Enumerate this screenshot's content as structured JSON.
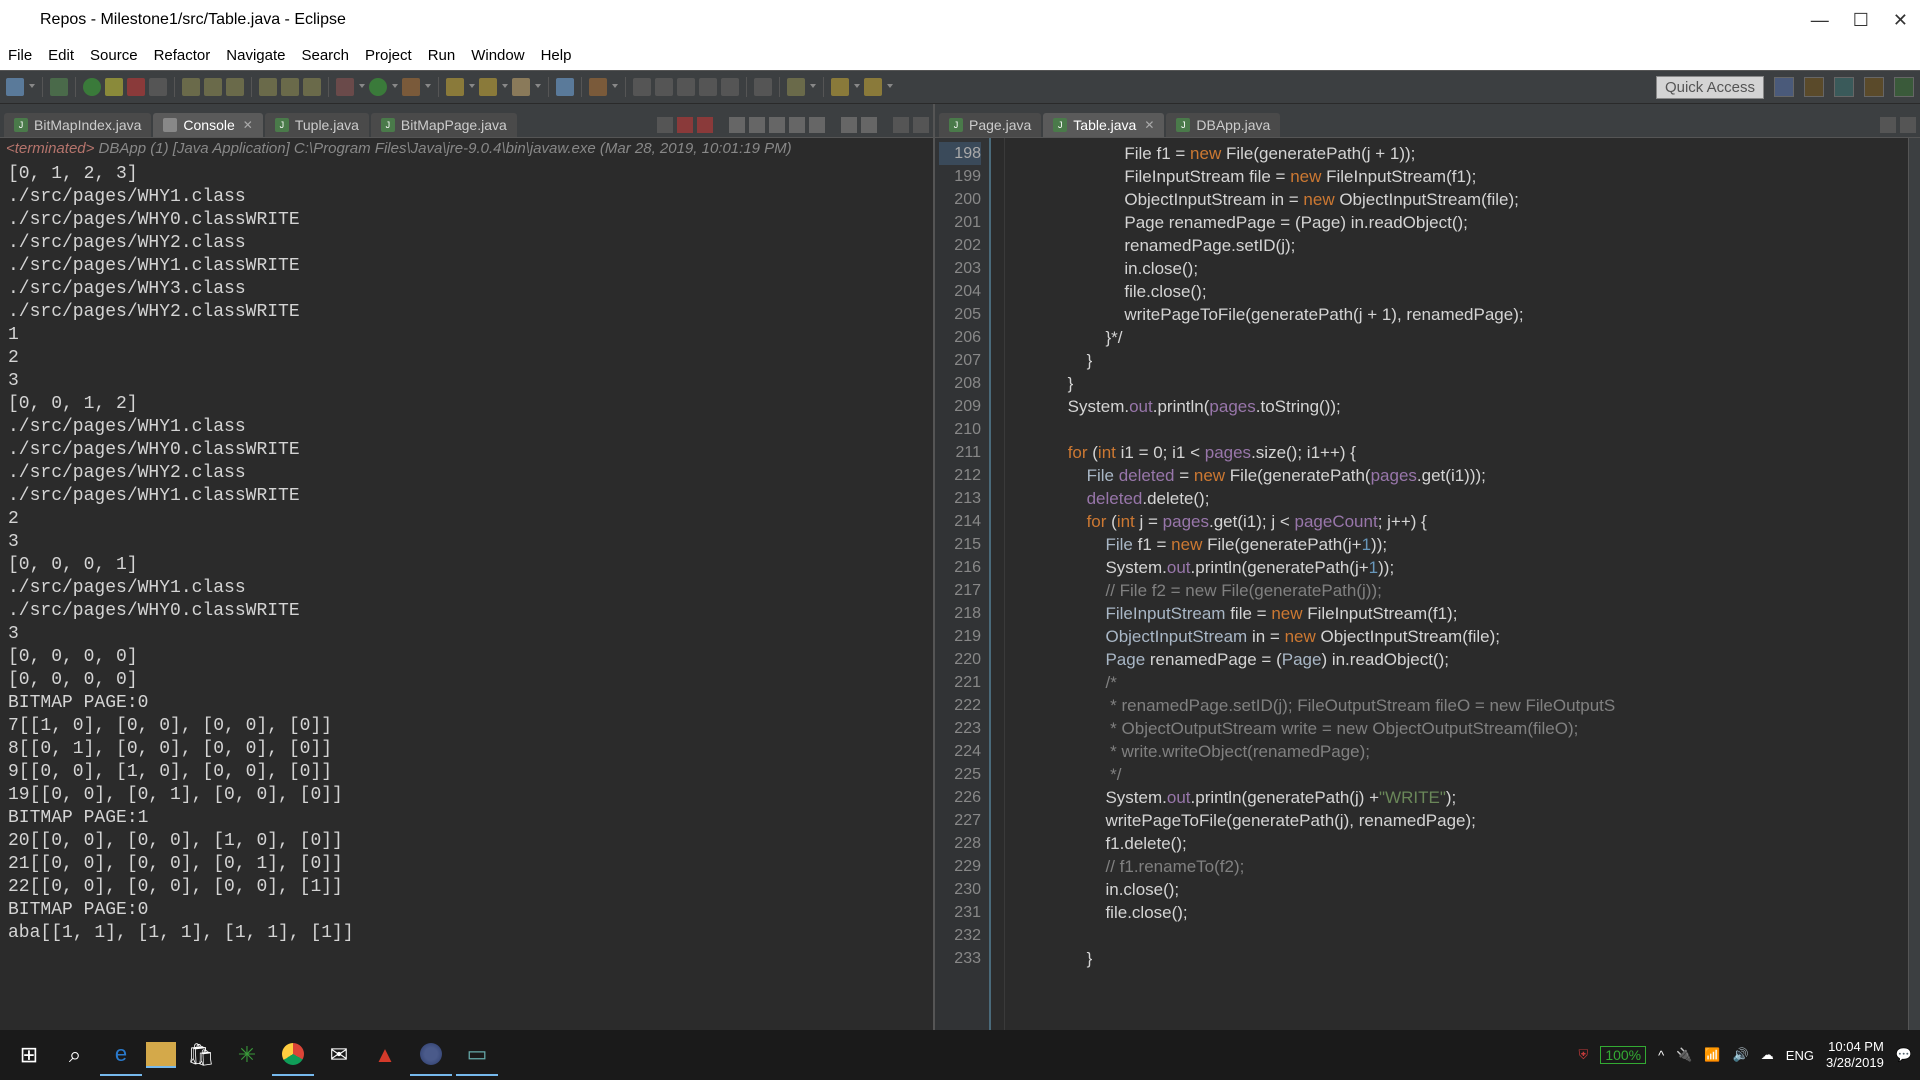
{
  "window": {
    "title": "Repos - Milestone1/src/Table.java - Eclipse"
  },
  "menu": {
    "items": [
      "File",
      "Edit",
      "Source",
      "Refactor",
      "Navigate",
      "Search",
      "Project",
      "Run",
      "Window",
      "Help"
    ]
  },
  "quickaccess": "Quick Access",
  "left_tabs": [
    {
      "label": "BitMapIndex.java",
      "icon": "j",
      "active": false
    },
    {
      "label": "Console",
      "icon": "c",
      "active": true,
      "closable": true
    },
    {
      "label": "Tuple.java",
      "icon": "j",
      "active": false
    },
    {
      "label": "BitMapPage.java",
      "icon": "j",
      "active": false
    }
  ],
  "right_tabs": [
    {
      "label": "Page.java",
      "icon": "j",
      "active": false
    },
    {
      "label": "Table.java",
      "icon": "j",
      "active": true,
      "closable": true
    },
    {
      "label": "DBApp.java",
      "icon": "j",
      "active": false
    }
  ],
  "terminated": {
    "prefix": "<terminated>",
    "body": " DBApp (1) [Java Application] C:\\Program Files\\Java\\jre-9.0.4\\bin\\javaw.exe (Mar 28, 2019, 10:01:19 PM)"
  },
  "console_output": "[0, 1, 2, 3]\n./src/pages/WHY1.class\n./src/pages/WHY0.classWRITE\n./src/pages/WHY2.class\n./src/pages/WHY1.classWRITE\n./src/pages/WHY3.class\n./src/pages/WHY2.classWRITE\n1\n2\n3\n[0, 0, 1, 2]\n./src/pages/WHY1.class\n./src/pages/WHY0.classWRITE\n./src/pages/WHY2.class\n./src/pages/WHY1.classWRITE\n2\n3\n[0, 0, 0, 1]\n./src/pages/WHY1.class\n./src/pages/WHY0.classWRITE\n3\n[0, 0, 0, 0]\n[0, 0, 0, 0]\nBITMAP PAGE:0\n7[[1, 0], [0, 0], [0, 0], [0]]\n8[[0, 1], [0, 0], [0, 0], [0]]\n9[[0, 0], [1, 0], [0, 0], [0]]\n19[[0, 0], [0, 1], [0, 0], [0]]\nBITMAP PAGE:1\n20[[0, 0], [0, 0], [1, 0], [0]]\n21[[0, 0], [0, 0], [0, 1], [0]]\n22[[0, 0], [0, 0], [0, 0], [1]]\nBITMAP PAGE:0\naba[[1, 1], [1, 1], [1, 1], [1]]",
  "editor": {
    "first_line": 198,
    "lines": [
      {
        "n": 198,
        "hl": true,
        "html": "                        File f1 = <span class='kw'>new</span> File(generatePath(j + 1));"
      },
      {
        "n": 199,
        "html": "                        FileInputStream file = <span class='kw'>new</span> FileInputStream(f1);"
      },
      {
        "n": 200,
        "html": "                        ObjectInputStream in = <span class='kw'>new</span> ObjectInputStream(file);"
      },
      {
        "n": 201,
        "html": "                        Page renamedPage = (Page) in.readObject();"
      },
      {
        "n": 202,
        "html": "                        renamedPage.setID(j);"
      },
      {
        "n": 203,
        "html": "                        in.close();"
      },
      {
        "n": 204,
        "html": "                        file.close();"
      },
      {
        "n": 205,
        "html": "                        writePageToFile(generatePath(j + 1), renamedPage);"
      },
      {
        "n": 206,
        "html": "                    }*/"
      },
      {
        "n": 207,
        "html": "                }"
      },
      {
        "n": 208,
        "html": "            }"
      },
      {
        "n": 209,
        "html": "            System.<span class='fld'>out</span>.println(<span class='fld'>pages</span>.toString());"
      },
      {
        "n": 210,
        "html": ""
      },
      {
        "n": 211,
        "html": "            <span class='kw'>for</span> (<span class='kw'>int</span> i1 = 0; i1 &lt; <span class='fld'>pages</span>.size(); i1++) {"
      },
      {
        "n": 212,
        "html": "                <span class='typ'>File</span> <span class='fld'>deleted</span> = <span class='kw'>new</span> File(generatePath(<span class='fld'>pages</span>.get(i1)));"
      },
      {
        "n": 213,
        "html": "                <span class='fld'>deleted</span>.delete();"
      },
      {
        "n": 214,
        "html": "                <span class='kw'>for</span> (<span class='kw'>int</span> j = <span class='fld'>pages</span>.get(i1); j &lt; <span class='fld'>pageCount</span>; j++) {"
      },
      {
        "n": 215,
        "html": "                    <span class='typ'>File</span> f1 = <span class='kw'>new</span> File(generatePath(j+<span class='num'>1</span>));"
      },
      {
        "n": 216,
        "html": "                    System.<span class='fld'>out</span>.println(generatePath(j+<span class='num'>1</span>));"
      },
      {
        "n": 217,
        "html": "                    <span class='cmt'>// File f2 = new File(generatePath(j));</span>"
      },
      {
        "n": 218,
        "html": "                    <span class='typ'>FileInputStream</span> file = <span class='kw'>new</span> FileInputStream(f1);"
      },
      {
        "n": 219,
        "html": "                    <span class='typ'>ObjectInputStream</span> in = <span class='kw'>new</span> ObjectInputStream(file);"
      },
      {
        "n": 220,
        "html": "                    <span class='typ'>Page</span> renamedPage = (<span class='typ'>Page</span>) in.readObject();"
      },
      {
        "n": 221,
        "html": "                    <span class='cmt'>/*</span>"
      },
      {
        "n": 222,
        "html": "<span class='cmt'>                     * renamedPage.setID(j); FileOutputStream fileO = new FileOutputS</span>"
      },
      {
        "n": 223,
        "html": "<span class='cmt'>                     * ObjectOutputStream write = new ObjectOutputStream(fileO);</span>"
      },
      {
        "n": 224,
        "html": "<span class='cmt'>                     * write.writeObject(renamedPage);</span>"
      },
      {
        "n": 225,
        "html": "<span class='cmt'>                     */</span>"
      },
      {
        "n": 226,
        "html": "                    System.<span class='fld'>out</span>.println(generatePath(j) +<span class='str'>\"WRITE\"</span>);"
      },
      {
        "n": 227,
        "html": "                    writePageToFile(generatePath(j), renamedPage);"
      },
      {
        "n": 228,
        "html": "                    f1.delete();"
      },
      {
        "n": 229,
        "html": "                    <span class='cmt'>// f1.renameTo(f2);</span>"
      },
      {
        "n": 230,
        "html": "                    in.close();"
      },
      {
        "n": 231,
        "html": "                    file.close();"
      },
      {
        "n": 232,
        "html": ""
      },
      {
        "n": 233,
        "html": "                }"
      }
    ]
  },
  "tray": {
    "battery": "100%",
    "lang": "ENG",
    "time": "10:04 PM",
    "date": "3/28/2019"
  }
}
